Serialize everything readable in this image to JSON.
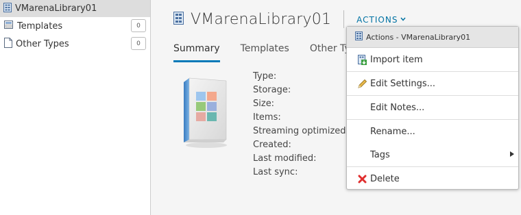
{
  "tree": {
    "root_label": "VMarenaLibrary01",
    "items": [
      {
        "label": "Templates",
        "badge": "0"
      },
      {
        "label": "Other Types",
        "badge": "0"
      }
    ]
  },
  "header": {
    "title": "VMarenaLibrary01",
    "actions_label": "ACTIONS"
  },
  "tabs": [
    {
      "label": "Summary",
      "active": true
    },
    {
      "label": "Templates",
      "active": false
    },
    {
      "label": "Other Ty",
      "active": false
    }
  ],
  "properties": [
    "Type:",
    "Storage:",
    "Size:",
    "Items:",
    "Streaming optimized:",
    "Created:",
    "Last modified:",
    "Last sync:"
  ],
  "menu": {
    "header": "Actions - VMarenaLibrary01",
    "items": [
      {
        "label": "Import item",
        "icon": "import-icon"
      },
      {
        "label": "Edit Settings...",
        "icon": "pencil-icon"
      },
      {
        "label": "Edit Notes...",
        "icon": ""
      },
      {
        "label": "Rename...",
        "icon": ""
      },
      {
        "label": "Tags",
        "icon": "",
        "submenu": true
      },
      {
        "label": "Delete",
        "icon": "delete-x-icon"
      }
    ]
  },
  "colors": {
    "accent": "#0079b8",
    "link": "#0072a3",
    "delete": "#e02e2e"
  }
}
